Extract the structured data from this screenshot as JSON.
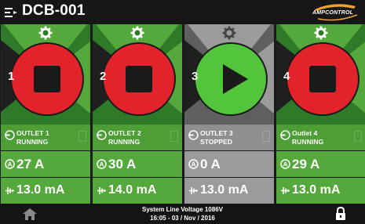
{
  "header": {
    "title": "DCB-001",
    "logo_text": "AMPCONTROL",
    "logo_accent": "#f0a32e"
  },
  "colors": {
    "running_dark": "#2f7a28",
    "running_light": "#55a93c",
    "stop_red": "#e3232b",
    "stopped_grey": "#9b9b9b",
    "play_green": "#52c53c"
  },
  "outlets": [
    {
      "number": "1",
      "state": "running",
      "status_line1": "OUTLET 1",
      "status_line2": "RUNNING",
      "current": "27 A",
      "leakage": "13.0 mA",
      "control_icon": "stop-icon"
    },
    {
      "number": "2",
      "state": "running",
      "status_line1": "OUTLET 2",
      "status_line2": "RUNNING",
      "current": "30 A",
      "leakage": "14.0 mA",
      "control_icon": "stop-icon"
    },
    {
      "number": "3",
      "state": "stopped",
      "status_line1": "OUTLET 3",
      "status_line2": "STOPPED",
      "current": "0 A",
      "leakage": "13.0 mA",
      "control_icon": "play-icon"
    },
    {
      "number": "4",
      "state": "running",
      "status_line1": "Outlet 4",
      "status_line2": "RUNNING",
      "current": "29 A",
      "leakage": "13.0 mA",
      "control_icon": "stop-icon"
    }
  ],
  "footer": {
    "line1": "System Line Voltage 1086V",
    "line2": "16:05 - 03 / Nov / 2016"
  },
  "icons": {
    "menu": "menu-icon",
    "home": "home-icon",
    "lock": "lock-icon",
    "gear": "gear-icon"
  }
}
